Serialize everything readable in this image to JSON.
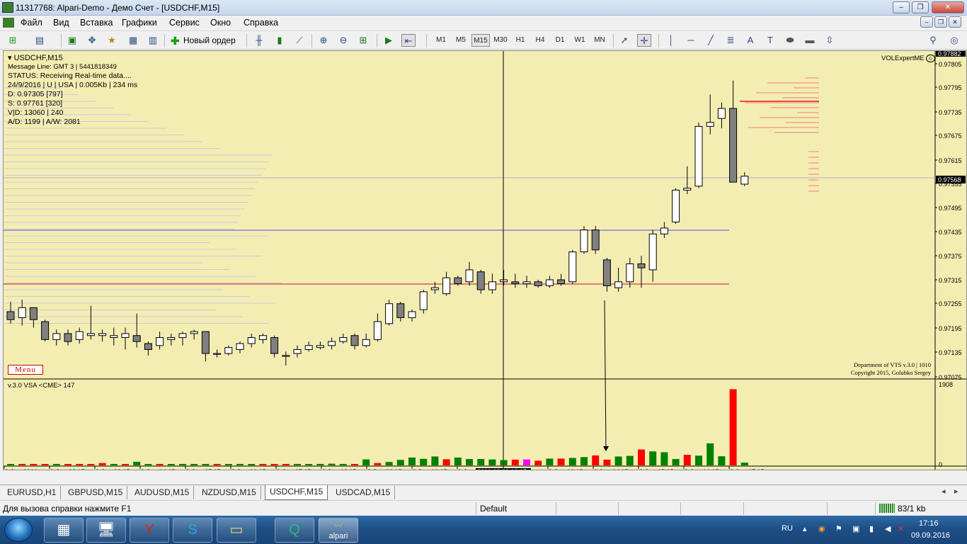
{
  "window": {
    "title": "11317768: Alpari-Demo - Демо Счет - [USDCHF,M15]"
  },
  "menu": [
    "Файл",
    "Вид",
    "Вставка",
    "Графики",
    "Сервис",
    "Окно",
    "Справка"
  ],
  "toolbar": {
    "new_order_label": "Новый ордер",
    "timeframes": [
      "M1",
      "M5",
      "M15",
      "M30",
      "H1",
      "H4",
      "D1",
      "W1",
      "MN"
    ],
    "active_timeframe": "M15",
    "icons": [
      "new-chart-icon",
      "profiles-icon",
      "market-watch-icon",
      "navigator-icon",
      "terminal-icon",
      "strategy-tester-icon",
      "new-order-icon",
      "bar-chart-icon",
      "candlesticks-icon",
      "line-chart-icon",
      "zoom-in-icon",
      "zoom-out-icon",
      "tile-windows-icon",
      "autoscroll-icon",
      "chart-shift-icon",
      "cursor-icon",
      "crosshair-icon",
      "vertical-line-icon",
      "horizontal-line-icon",
      "trendline-icon",
      "fibonacci-icon",
      "text-icon",
      "text-label-icon",
      "ellipse-icon",
      "rectangle-icon",
      "arrows-icon",
      "search-icon",
      "community-icon"
    ]
  },
  "chart": {
    "symbol_label": "USDCHF,M15",
    "info_lines": [
      "Message Line: GMT 3 | 5441818349",
      "STATUS:  Receiving Real-time data....",
      "24/9/2016 | U | USA | 0.005Kb | 234 ms",
      "D: 0.97305  [797]",
      "S: 0.97761  [320]",
      "V|D: 13060 | 240",
      "A/D: 1199 | A/W: 2081"
    ],
    "expert_label": "VOLExpertME",
    "menu_button": "Menu",
    "copyright_lines": [
      "Department of VTS  v.3.0 | 1010",
      "Copyright 2015, Golubko Sergey"
    ],
    "price_labels": [
      "0.97882",
      "0.97805",
      "0.97795",
      "0.97735",
      "0.97675",
      "0.97615",
      "0.97555",
      "0.97568",
      "0.97495",
      "0.97435",
      "0.97375",
      "0.97315",
      "0.97255",
      "0.97195",
      "0.97135",
      "0.97075"
    ],
    "current_price": "0.97568",
    "crosshair_time": "2016.09.09 12:15",
    "time_labels": [
      "9 Sep 2016",
      "9 Sep 02:15",
      "9 Sep 03:15",
      "9 Sep 04:15",
      "9 Sep 05:15",
      "9 Sep 06:15",
      "9 Sep 07:15",
      "9 Sep 08:15",
      "9 Sep 09:15",
      "9 Sep 10:15",
      "9 Sep",
      "9 Sep 13:15",
      "9 Sep 14:15",
      "9 Sep 15:15",
      "9 Sep 16:15",
      "9 Sep 17:15"
    ],
    "indicator_label": "v.3.0 VSA <CME> 147",
    "indicator_scale": [
      "1908",
      "0"
    ],
    "colors": {
      "background": "#f4edb2",
      "bull": "#ffffff",
      "bear": "#808080",
      "vol_up": "#008000",
      "vol_down": "#ff0000",
      "crosshair": "#000000"
    }
  },
  "chart_data": {
    "type": "candlestick",
    "title": "USDCHF,M15",
    "ylim": [
      0.97075,
      0.97882
    ],
    "candles": [
      [
        0.97235,
        0.9726,
        0.97205,
        0.97215
      ],
      [
        0.9722,
        0.97265,
        0.972,
        0.97245
      ],
      [
        0.97245,
        0.97245,
        0.97195,
        0.97215
      ],
      [
        0.9721,
        0.97215,
        0.9716,
        0.97165
      ],
      [
        0.97165,
        0.9719,
        0.9715,
        0.9718
      ],
      [
        0.9718,
        0.9719,
        0.9715,
        0.9716
      ],
      [
        0.97165,
        0.97195,
        0.97155,
        0.97185
      ],
      [
        0.97175,
        0.9725,
        0.97165,
        0.9718
      ],
      [
        0.97175,
        0.9719,
        0.9716,
        0.9718
      ],
      [
        0.9717,
        0.97195,
        0.9715,
        0.97175
      ],
      [
        0.9717,
        0.97195,
        0.9714,
        0.9718
      ],
      [
        0.97175,
        0.9723,
        0.97145,
        0.9716
      ],
      [
        0.97155,
        0.9716,
        0.97125,
        0.9714
      ],
      [
        0.9715,
        0.97185,
        0.9714,
        0.9717
      ],
      [
        0.97165,
        0.9718,
        0.9715,
        0.9717
      ],
      [
        0.9717,
        0.97185,
        0.9715,
        0.9718
      ],
      [
        0.9718,
        0.9719,
        0.97165,
        0.97185
      ],
      [
        0.97185,
        0.97185,
        0.9711,
        0.9713
      ],
      [
        0.9713,
        0.9714,
        0.9712,
        0.9713
      ],
      [
        0.9713,
        0.9715,
        0.97125,
        0.97145
      ],
      [
        0.9714,
        0.9716,
        0.9713,
        0.97155
      ],
      [
        0.97155,
        0.9718,
        0.97145,
        0.9717
      ],
      [
        0.97165,
        0.9718,
        0.97155,
        0.97175
      ],
      [
        0.9717,
        0.97175,
        0.9712,
        0.9713
      ],
      [
        0.97125,
        0.97135,
        0.971,
        0.97125
      ],
      [
        0.9713,
        0.9715,
        0.9712,
        0.9714
      ],
      [
        0.9714,
        0.9716,
        0.97135,
        0.9715
      ],
      [
        0.97145,
        0.9716,
        0.9714,
        0.9715
      ],
      [
        0.9715,
        0.9717,
        0.9714,
        0.9716
      ],
      [
        0.9716,
        0.9718,
        0.97155,
        0.9717
      ],
      [
        0.97175,
        0.9718,
        0.9714,
        0.9715
      ],
      [
        0.9715,
        0.9718,
        0.97145,
        0.97165
      ],
      [
        0.97165,
        0.9723,
        0.9716,
        0.9721
      ],
      [
        0.97205,
        0.97265,
        0.972,
        0.97255
      ],
      [
        0.97255,
        0.9726,
        0.9721,
        0.9722
      ],
      [
        0.9722,
        0.9724,
        0.9721,
        0.97235
      ],
      [
        0.9724,
        0.9729,
        0.9723,
        0.97285
      ],
      [
        0.9729,
        0.9731,
        0.9728,
        0.97295
      ],
      [
        0.9728,
        0.97335,
        0.97275,
        0.9732
      ],
      [
        0.9732,
        0.97325,
        0.973,
        0.97305
      ],
      [
        0.9731,
        0.9736,
        0.973,
        0.9734
      ],
      [
        0.97335,
        0.9734,
        0.9728,
        0.9729
      ],
      [
        0.9729,
        0.9733,
        0.9728,
        0.9731
      ],
      [
        0.9731,
        0.9734,
        0.973,
        0.97315
      ],
      [
        0.9731,
        0.9733,
        0.97295,
        0.97305
      ],
      [
        0.97305,
        0.97325,
        0.97295,
        0.9731
      ],
      [
        0.9731,
        0.97315,
        0.97295,
        0.973
      ],
      [
        0.973,
        0.97325,
        0.97295,
        0.97315
      ],
      [
        0.97315,
        0.9733,
        0.973,
        0.97305
      ],
      [
        0.9731,
        0.9739,
        0.97305,
        0.97385
      ],
      [
        0.97385,
        0.9745,
        0.9738,
        0.9744
      ],
      [
        0.9744,
        0.9745,
        0.9738,
        0.9739
      ],
      [
        0.97365,
        0.9737,
        0.97285,
        0.973
      ],
      [
        0.97295,
        0.97345,
        0.97285,
        0.9731
      ],
      [
        0.9731,
        0.9737,
        0.97295,
        0.97355
      ],
      [
        0.97355,
        0.97375,
        0.97295,
        0.97345
      ],
      [
        0.9734,
        0.9744,
        0.9731,
        0.9743
      ],
      [
        0.9743,
        0.9746,
        0.9742,
        0.97445
      ],
      [
        0.9746,
        0.97545,
        0.97455,
        0.9754
      ],
      [
        0.9754,
        0.976,
        0.9753,
        0.97545
      ],
      [
        0.9755,
        0.9771,
        0.97545,
        0.977
      ],
      [
        0.977,
        0.9778,
        0.9768,
        0.9771
      ],
      [
        0.9772,
        0.9776,
        0.97695,
        0.97745
      ],
      [
        0.97745,
        0.97815,
        0.97625,
        0.9756
      ],
      [
        0.97555,
        0.97585,
        0.9755,
        0.97575
      ]
    ],
    "volumes_note": "VSA volume histogram, max 1908",
    "volumes": [
      20,
      20,
      25,
      20,
      20,
      20,
      20,
      20,
      55,
      25,
      20,
      85,
      30,
      25,
      30,
      25,
      20,
      20,
      20,
      20,
      20,
      20,
      20,
      20,
      20,
      20,
      25,
      25,
      40,
      20,
      30,
      140,
      55,
      80,
      130,
      185,
      155,
      210,
      145,
      185,
      150,
      150,
      140,
      125,
      135,
      140,
      110,
      160,
      160,
      175,
      195,
      235,
      135,
      210,
      225,
      375,
      330,
      310,
      150,
      250,
      230,
      520,
      215,
      1800,
      65
    ],
    "volume_colors": [
      "g",
      "r",
      "r",
      "r",
      "g",
      "r",
      "r",
      "r",
      "r",
      "g",
      "r",
      "g",
      "g",
      "r",
      "g",
      "g",
      "g",
      "g",
      "r",
      "g",
      "g",
      "g",
      "r",
      "r",
      "r",
      "g",
      "g",
      "g",
      "g",
      "g",
      "r",
      "g",
      "r",
      "g",
      "g",
      "g",
      "g",
      "g",
      "r",
      "g",
      "g",
      "g",
      "g",
      "g",
      "r",
      "m",
      "r",
      "g",
      "r",
      "g",
      "g",
      "r",
      "r",
      "g",
      "g",
      "r",
      "g",
      "g",
      "g",
      "r",
      "g",
      "g",
      "g",
      "r",
      "g"
    ]
  },
  "tabs": [
    {
      "label": "EURUSD,H1",
      "active": false
    },
    {
      "label": "GBPUSD,M15",
      "active": false
    },
    {
      "label": "AUDUSD,M15",
      "active": false
    },
    {
      "label": "NZDUSD,M15",
      "active": false
    },
    {
      "label": "USDCHF,M15",
      "active": true
    },
    {
      "label": "USDCAD,M15",
      "active": false
    }
  ],
  "statusbar": {
    "help": "Для вызова справки нажмите F1",
    "profile": "Default",
    "traffic": "83/1 kb"
  },
  "taskbar": {
    "apps": [
      "calculator",
      "control-panel",
      "yandex",
      "skype",
      "file-manager",
      "quik",
      "alpari"
    ],
    "alpari_label": "alpari",
    "lang": "RU",
    "time": "17:16",
    "date": "09.09.2016"
  }
}
